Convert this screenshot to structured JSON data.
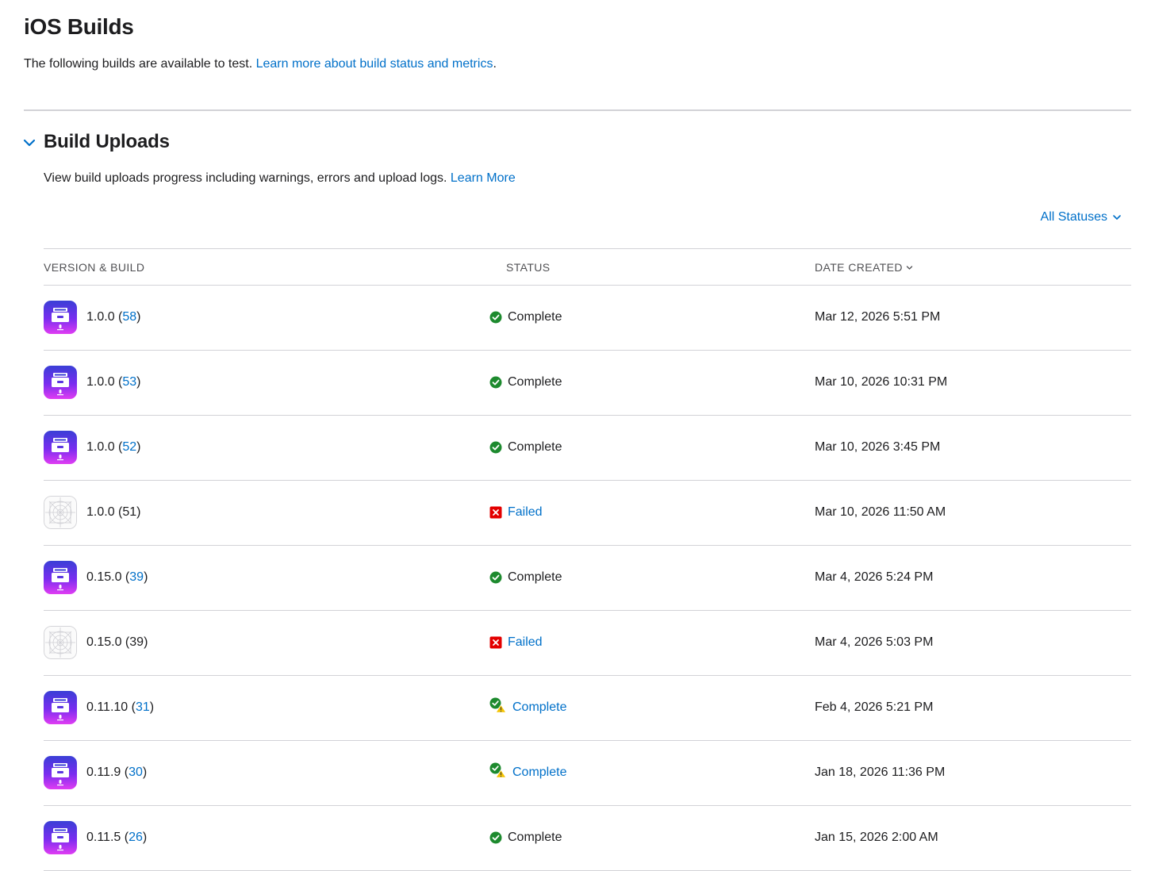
{
  "page": {
    "title": "iOS Builds",
    "intro_text": "The following builds are available to test. ",
    "intro_link": "Learn more about build status and metrics",
    "intro_suffix": "."
  },
  "section": {
    "title": "Build Uploads",
    "description": "View build uploads progress including warnings, errors and upload logs. ",
    "learn_more": "Learn More",
    "filter_label": "All Statuses"
  },
  "table": {
    "headers": {
      "version": "VERSION & BUILD",
      "status": "STATUS",
      "date": "DATE CREATED"
    },
    "rows": [
      {
        "icon": "app-icon",
        "version": "1.0.0",
        "build": "58",
        "build_link": true,
        "status": "Complete",
        "status_kind": "ok",
        "date": "Mar 12, 2026 5:51 PM"
      },
      {
        "icon": "app-icon",
        "version": "1.0.0",
        "build": "53",
        "build_link": true,
        "status": "Complete",
        "status_kind": "ok",
        "date": "Mar 10, 2026 10:31 PM"
      },
      {
        "icon": "app-icon",
        "version": "1.0.0",
        "build": "52",
        "build_link": true,
        "status": "Complete",
        "status_kind": "ok",
        "date": "Mar 10, 2026 3:45 PM"
      },
      {
        "icon": "placeholder-icon",
        "version": "1.0.0",
        "build": "51",
        "build_link": false,
        "status": "Failed",
        "status_kind": "fail",
        "date": "Mar 10, 2026 11:50 AM"
      },
      {
        "icon": "app-icon",
        "version": "0.15.0",
        "build": "39",
        "build_link": true,
        "status": "Complete",
        "status_kind": "ok",
        "date": "Mar 4, 2026 5:24 PM"
      },
      {
        "icon": "placeholder-icon",
        "version": "0.15.0",
        "build": "39",
        "build_link": false,
        "status": "Failed",
        "status_kind": "fail",
        "date": "Mar 4, 2026 5:03 PM"
      },
      {
        "icon": "app-icon",
        "version": "0.11.10",
        "build": "31",
        "build_link": true,
        "status": "Complete",
        "status_kind": "warn",
        "date": "Feb 4, 2026 5:21 PM"
      },
      {
        "icon": "app-icon",
        "version": "0.11.9",
        "build": "30",
        "build_link": true,
        "status": "Complete",
        "status_kind": "warn",
        "date": "Jan 18, 2026 11:36 PM"
      },
      {
        "icon": "app-icon",
        "version": "0.11.5",
        "build": "26",
        "build_link": true,
        "status": "Complete",
        "status_kind": "ok",
        "date": "Jan 15, 2026 2:00 AM"
      }
    ]
  },
  "colors": {
    "link": "#0070c9",
    "success": "#1d8a2e",
    "error": "#e30000",
    "warning": "#f5c400"
  }
}
